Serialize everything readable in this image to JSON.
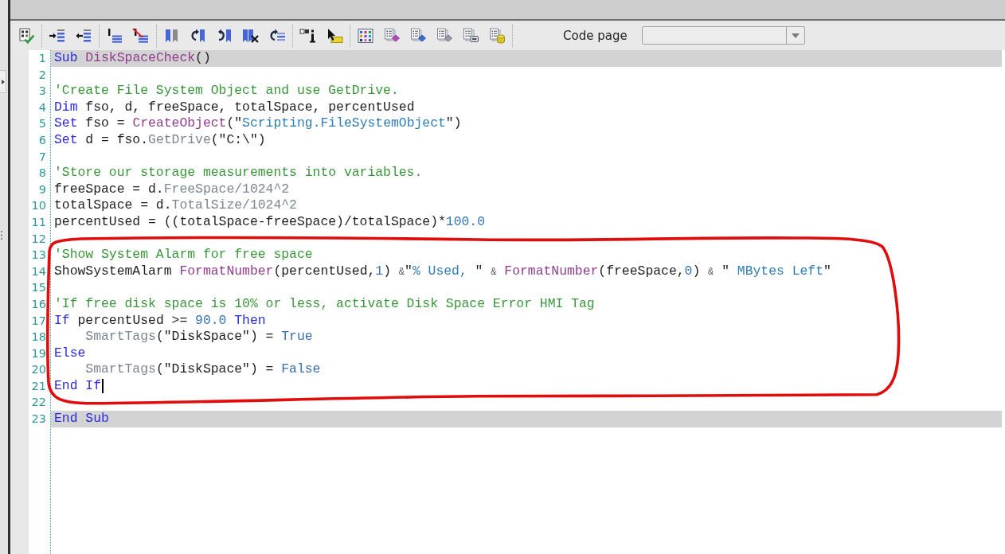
{
  "toolbar": {
    "code_page": {
      "label": "Code page"
    }
  },
  "editor": {
    "blocks": [
      {
        "kind": "plain",
        "lines": [
          {
            "number": "1",
            "highlighted": true,
            "caret": false,
            "tokens": [
              {
                "kind": "keyword",
                "text": "Sub "
              },
              {
                "kind": "function",
                "text": "DiskSpaceCheck"
              },
              {
                "kind": "plain",
                "text": "()"
              }
            ]
          },
          {
            "number": "2",
            "highlighted": false,
            "caret": false
          },
          {
            "number": "3",
            "highlighted": false,
            "caret": false,
            "tokens": [
              {
                "kind": "comment",
                "text": "'Create File System Object and use GetDrive."
              }
            ]
          },
          {
            "number": "4",
            "highlighted": false,
            "caret": false,
            "tokens": [
              {
                "kind": "keyword",
                "text": "Dim"
              },
              {
                "kind": "plain",
                "text": " fso, d, freeSpace, totalSpace, percentUsed"
              }
            ]
          },
          {
            "number": "5",
            "highlighted": false,
            "caret": false,
            "tokens": [
              {
                "kind": "keyword",
                "text": "Set"
              },
              {
                "kind": "plain",
                "text": " fso = "
              },
              {
                "kind": "function",
                "text": "CreateObject"
              },
              {
                "kind": "plain",
                "text": "(\""
              },
              {
                "kind": "string",
                "text": "Scripting.FileSystemObject"
              },
              {
                "kind": "plain",
                "text": "\")"
              }
            ]
          },
          {
            "number": "6",
            "highlighted": false,
            "caret": false,
            "tokens": [
              {
                "kind": "keyword",
                "text": "Set"
              },
              {
                "kind": "plain",
                "text": " d = fso."
              },
              {
                "kind": "member",
                "text": "GetDrive"
              },
              {
                "kind": "plain",
                "text": "(\"C:\\\")"
              }
            ]
          },
          {
            "number": "7",
            "highlighted": false,
            "caret": false
          },
          {
            "number": "8",
            "highlighted": false,
            "caret": false,
            "tokens": [
              {
                "kind": "comment",
                "text": "'Store our storage measurements into variables."
              }
            ]
          },
          {
            "number": "9",
            "highlighted": false,
            "caret": false,
            "tokens": [
              {
                "kind": "plain",
                "text": "freeSpace = d."
              },
              {
                "kind": "member",
                "text": "FreeSpace/1024^2"
              }
            ]
          },
          {
            "number": "10",
            "highlighted": false,
            "caret": false,
            "tokens": [
              {
                "kind": "plain",
                "text": "totalSpace = d."
              },
              {
                "kind": "member",
                "text": "TotalSize/1024^2"
              }
            ]
          },
          {
            "number": "11",
            "highlighted": false,
            "caret": false,
            "tokens": [
              {
                "kind": "plain",
                "text": "percentUsed = ((totalSpace-freeSpace)/totalSpace)*"
              },
              {
                "kind": "number",
                "text": "100.0"
              }
            ]
          },
          {
            "number": "12",
            "highlighted": false,
            "caret": false
          }
        ]
      },
      {
        "kind": "circled",
        "lines": [
          {
            "number": "13",
            "highlighted": false,
            "caret": false,
            "tokens": [
              {
                "kind": "comment",
                "text": "'Show System Alarm for free space"
              }
            ]
          },
          {
            "number": "14",
            "highlighted": false,
            "caret": false,
            "tokens": [
              {
                "kind": "plain",
                "text": "ShowSystemAlarm "
              },
              {
                "kind": "function",
                "text": "FormatNumber"
              },
              {
                "kind": "plain",
                "text": "(percentUsed,"
              },
              {
                "kind": "number",
                "text": "1"
              },
              {
                "kind": "plain",
                "text": ") "
              },
              {
                "kind": "operator",
                "text": "&"
              },
              {
                "kind": "plain",
                "text": "\""
              },
              {
                "kind": "string",
                "text": "% Used, "
              },
              {
                "kind": "plain",
                "text": "\" "
              },
              {
                "kind": "operator",
                "text": "&"
              },
              {
                "kind": "function",
                "text": " FormatNumber"
              },
              {
                "kind": "plain",
                "text": "(freeSpace,"
              },
              {
                "kind": "number",
                "text": "0"
              },
              {
                "kind": "plain",
                "text": ") "
              },
              {
                "kind": "operator",
                "text": "&"
              },
              {
                "kind": "plain",
                "text": " \""
              },
              {
                "kind": "string",
                "text": " MBytes Left"
              },
              {
                "kind": "plain",
                "text": "\""
              }
            ]
          },
          {
            "number": "15",
            "highlighted": false,
            "caret": false
          },
          {
            "number": "16",
            "highlighted": false,
            "caret": false,
            "tokens": [
              {
                "kind": "comment",
                "text": "'If free disk space is 10% or less, activate Disk Space Error HMI Tag"
              }
            ]
          },
          {
            "number": "17",
            "highlighted": false,
            "caret": false,
            "tokens": [
              {
                "kind": "keyword",
                "text": "If"
              },
              {
                "kind": "plain",
                "text": " percentUsed >= "
              },
              {
                "kind": "number",
                "text": "90.0"
              },
              {
                "kind": "keyword",
                "text": " Then"
              }
            ]
          },
          {
            "number": "18",
            "highlighted": false,
            "caret": false,
            "tokens": [
              {
                "kind": "member",
                "text": "    SmartTags"
              },
              {
                "kind": "plain",
                "text": "(\"DiskSpace\") = "
              },
              {
                "kind": "literal",
                "text": "True"
              }
            ]
          },
          {
            "number": "19",
            "highlighted": false,
            "caret": false,
            "tokens": [
              {
                "kind": "keyword",
                "text": "Else"
              }
            ]
          },
          {
            "number": "20",
            "highlighted": false,
            "caret": false,
            "tokens": [
              {
                "kind": "member",
                "text": "    SmartTags"
              },
              {
                "kind": "plain",
                "text": "(\"DiskSpace\") = "
              },
              {
                "kind": "literal",
                "text": "False"
              }
            ]
          },
          {
            "number": "21",
            "highlighted": false,
            "caret": true,
            "tokens": [
              {
                "kind": "keyword",
                "text": "End If"
              }
            ]
          }
        ]
      },
      {
        "kind": "plain",
        "lines": [
          {
            "number": "22",
            "highlighted": false,
            "caret": false
          },
          {
            "number": "23",
            "highlighted": true,
            "caret": false,
            "tokens": [
              {
                "kind": "keyword",
                "text": "End Sub"
              }
            ]
          }
        ]
      }
    ]
  }
}
